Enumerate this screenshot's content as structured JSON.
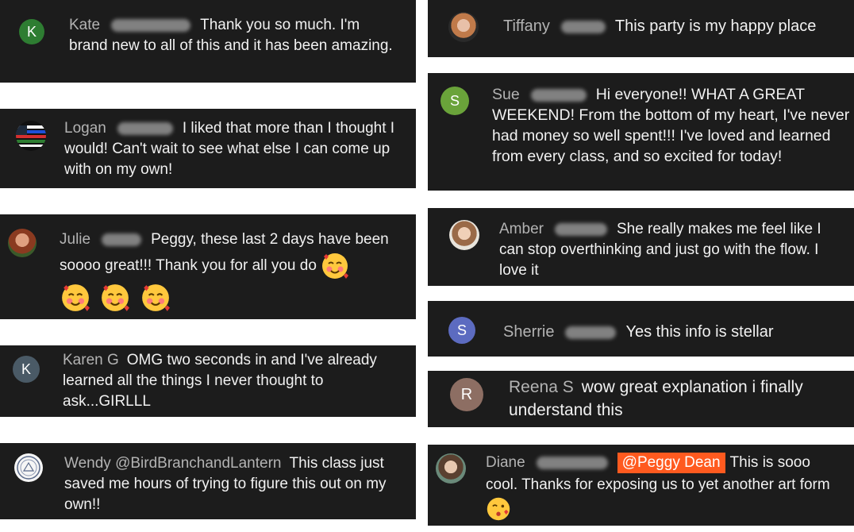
{
  "comments": [
    {
      "author": "Kate",
      "initial": "K",
      "avatar_color": "#2e7d32",
      "text": "Thank you so much. I'm brand new to all of this and it has been amazing."
    },
    {
      "author": "Logan",
      "text": "I liked that more than I thought I would! Can't wait to see what else I can come up with on my own!"
    },
    {
      "author": "Julie",
      "text": "Peggy, these last 2 days have been soooo great!!! Thank you for all you do"
    },
    {
      "author": "Karen G",
      "initial": "K",
      "avatar_color": "#4a5a66",
      "text": "OMG two seconds in and I've already learned all the things I never thought to ask...GIRLLL"
    },
    {
      "author": "Wendy @BirdBranchandLantern",
      "text": "This class just saved me hours of trying to figure this out on my own!!"
    },
    {
      "author": "Tiffany",
      "text": "This party is my happy place"
    },
    {
      "author": "Sue",
      "initial": "S",
      "avatar_color": "#6aa33a",
      "text": "Hi everyone!! WHAT A GREAT WEEKEND! From the bottom of my heart, I've never had money so well spent!!! I've loved and learned from every class, and so excited for today!"
    },
    {
      "author": "Amber",
      "text": "She really makes me feel like I can stop overthinking and just go with the flow. I love it"
    },
    {
      "author": "Sherrie",
      "initial": "S",
      "avatar_color": "#5c6bc0",
      "text": "Yes this info is stellar"
    },
    {
      "author": "Reena S",
      "initial": "R",
      "avatar_color": "#8d6e63",
      "text": "wow great explanation i finally understand this"
    },
    {
      "author": "Diane",
      "mention": "@Peggy Dean",
      "text": "This is sooo cool. Thanks for exposing us to yet another art form"
    }
  ],
  "colors": {
    "background": "#ffffff",
    "card": "#1c1c1c",
    "author_text": "#b3b3b3",
    "message_text": "#f1f1f1",
    "mention_bg": "#ff5a1f"
  },
  "icons": [
    "smiling-face-with-hearts-emoji",
    "kissing-face-emoji",
    "flag-avatar",
    "seal-avatar",
    "photo-avatar"
  ]
}
